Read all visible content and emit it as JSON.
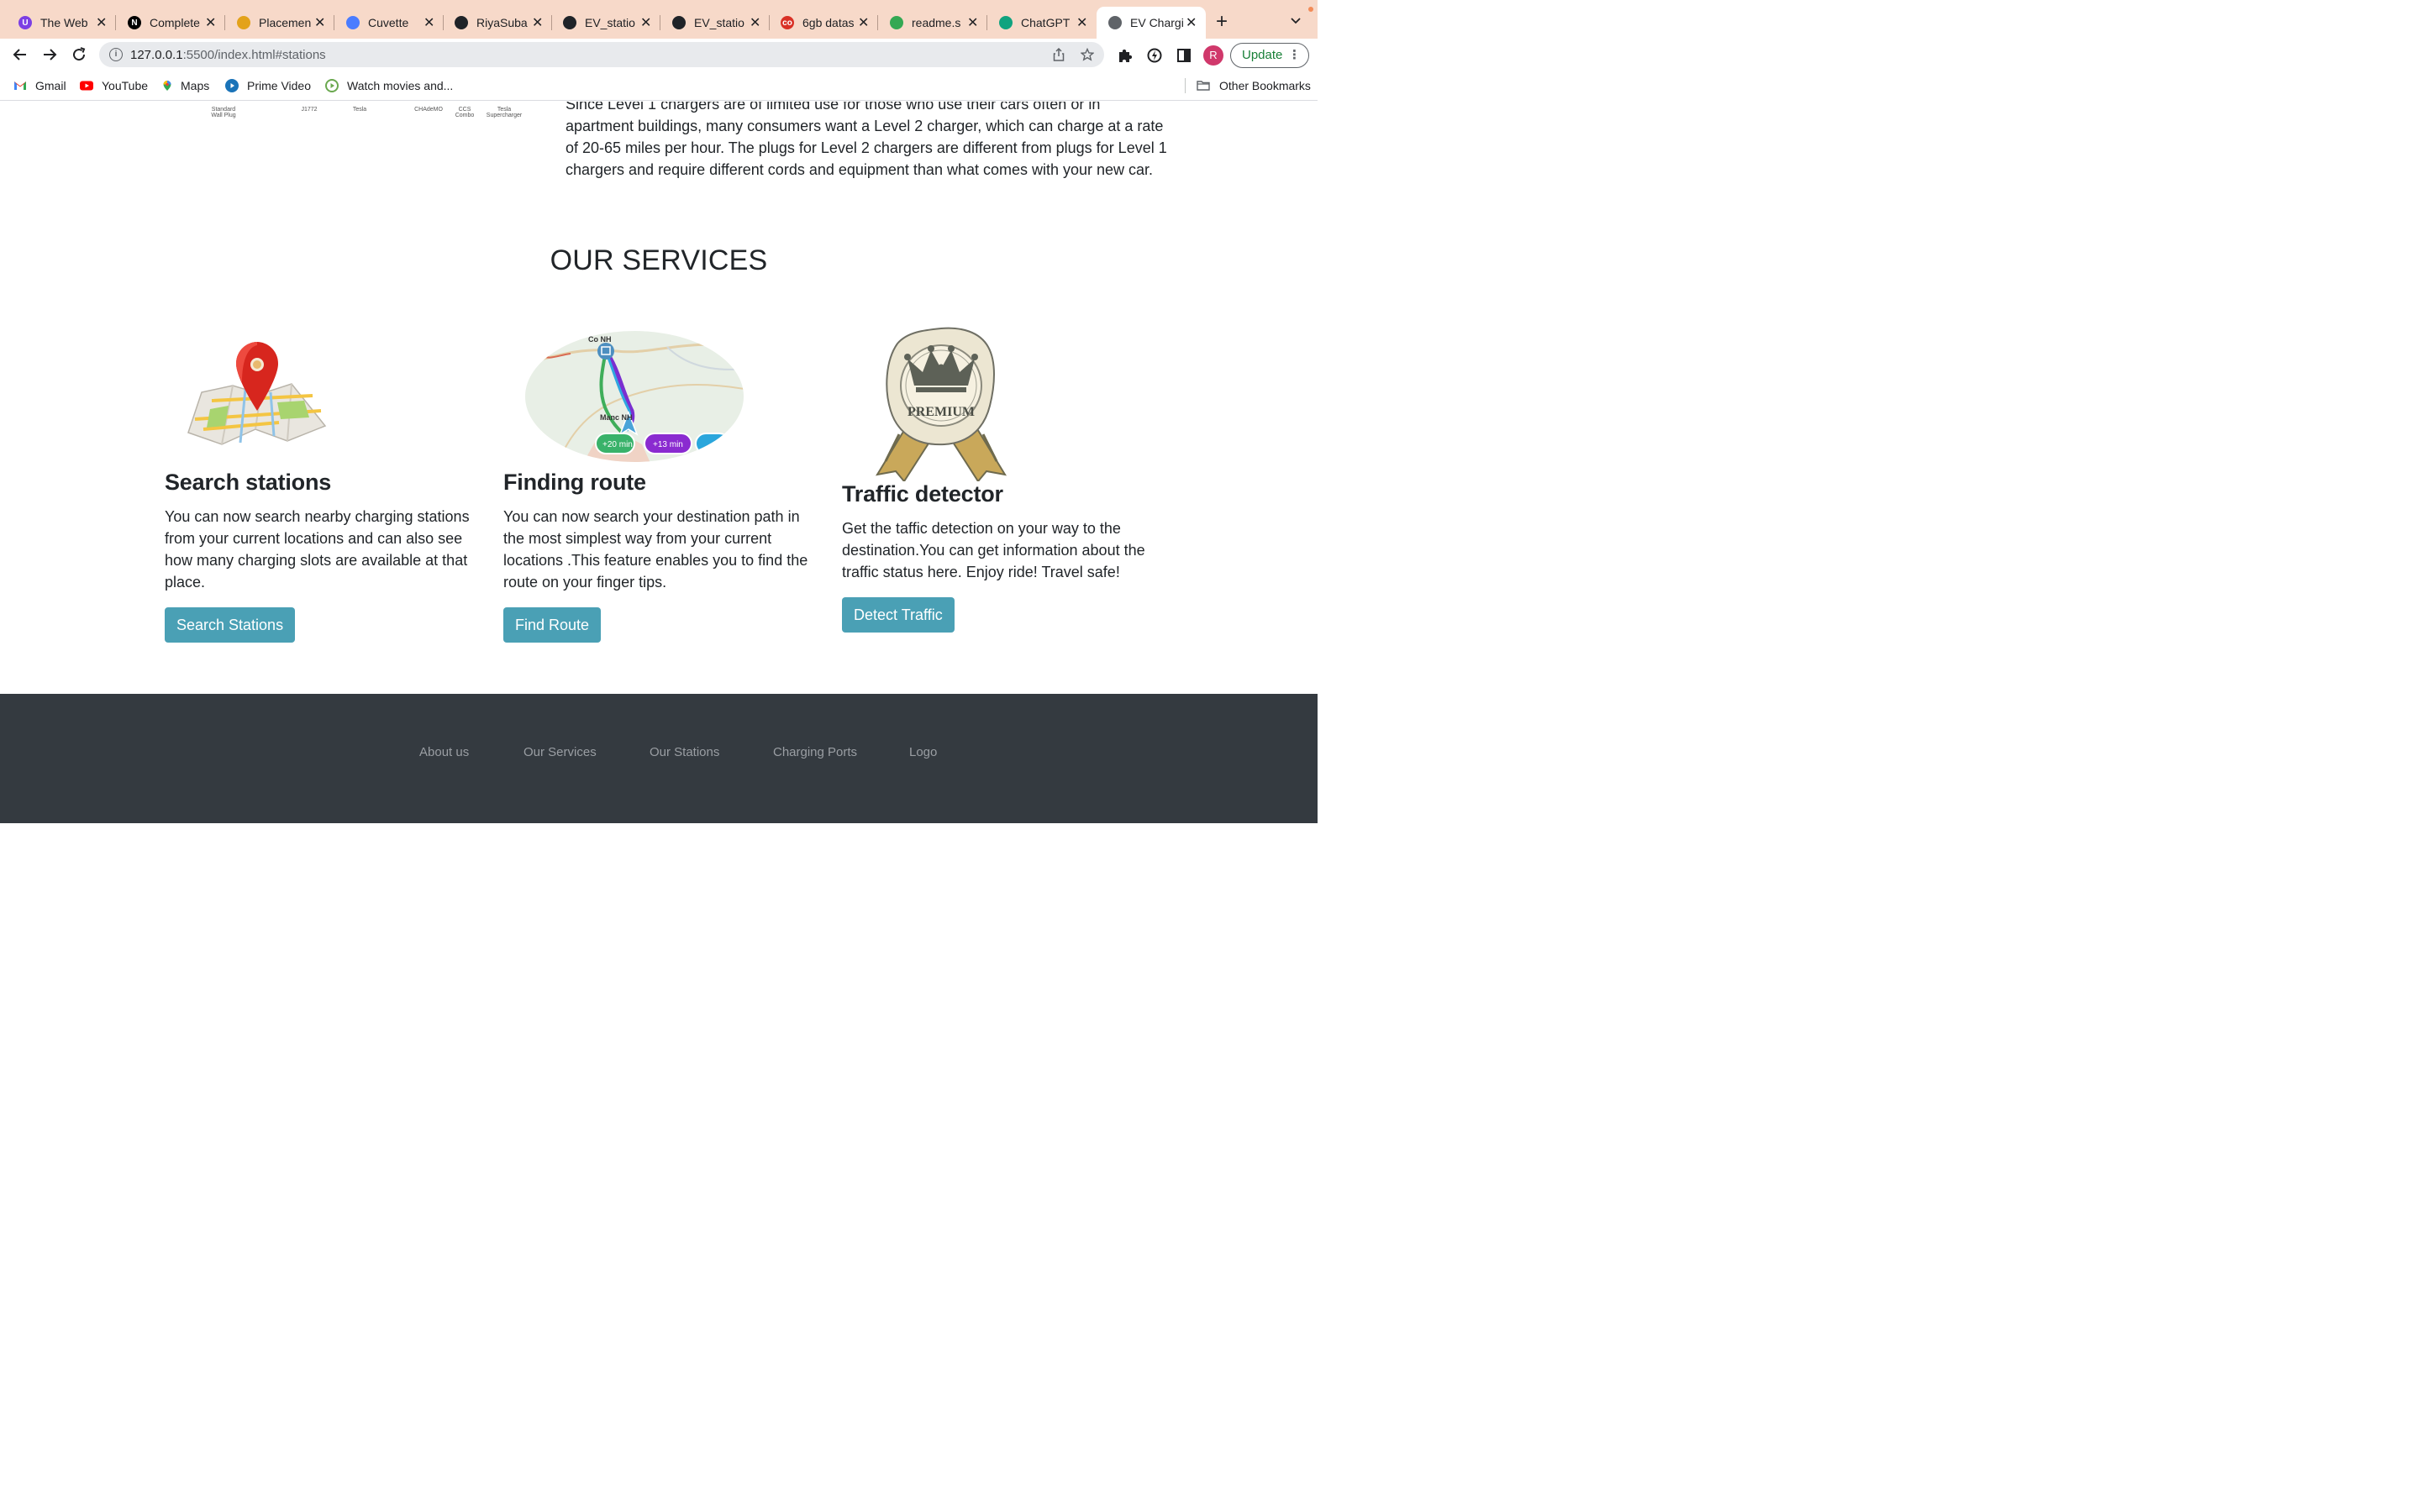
{
  "browser": {
    "tabs": [
      {
        "title": "The Web",
        "color": "#7b3fe4",
        "glyph": "U"
      },
      {
        "title": "Complete",
        "color": "#000000",
        "glyph": "N"
      },
      {
        "title": "Placemen",
        "color": "#e3a21a",
        "glyph": ""
      },
      {
        "title": "Cuvette",
        "color": "#4a7cff",
        "glyph": ""
      },
      {
        "title": "RiyaSuba",
        "color": "#1f2328",
        "glyph": ""
      },
      {
        "title": "EV_statio",
        "color": "#1f2328",
        "glyph": ""
      },
      {
        "title": "EV_statio",
        "color": "#1f2328",
        "glyph": ""
      },
      {
        "title": "6gb datas",
        "color": "#d93025",
        "glyph": "co"
      },
      {
        "title": "readme.s",
        "color": "#34a853",
        "glyph": ""
      },
      {
        "title": "ChatGPT",
        "color": "#10a37f",
        "glyph": ""
      },
      {
        "title": "EV Chargi",
        "color": "#5f6368",
        "glyph": "",
        "active": true
      }
    ],
    "url_host": "127.0.0.1",
    "url_rest": ":5500/index.html#stations",
    "profile_initial": "R",
    "update_label": "Update",
    "bookmarks": [
      {
        "label": "Gmail",
        "icon": "gmail-icon",
        "color": "#ea4335"
      },
      {
        "label": "YouTube",
        "icon": "youtube-icon",
        "color": "#ff0000"
      },
      {
        "label": "Maps",
        "icon": "maps-icon",
        "color": "#34a853"
      },
      {
        "label": "Prime Video",
        "icon": "prime-video-icon",
        "color": "#1a73b8"
      },
      {
        "label": "Watch movies and...",
        "icon": "watch-movies-icon",
        "color": "#6aa84f"
      }
    ],
    "other_bookmarks": "Other Bookmarks"
  },
  "page": {
    "plug_labels": [
      {
        "lines": [
          "Standard",
          "Wall Plug"
        ]
      },
      {
        "lines": [
          "J1772"
        ]
      },
      {
        "lines": [
          "Tesla"
        ]
      },
      {
        "lines": [
          "CHAdeMO"
        ]
      },
      {
        "lines": [
          "CCS",
          "Combo"
        ]
      },
      {
        "lines": [
          "Tesla",
          "Supercharger"
        ]
      }
    ],
    "intro_paragraph": "Since Level 1 chargers are of limited use for those who use their cars often or in apartment buildings, many consumers want a Level 2 charger, which can charge at a rate of 20-65 miles per hour. The plugs for Level 2 chargers are different from plugs for Level 1 chargers and require different cords and equipment than what comes with your new car.",
    "services_heading": "OUR SERVICES",
    "services": [
      {
        "title": "Search stations",
        "description": "You can now search nearby charging stations from your current locations and can also see how many charging slots are available at that place.",
        "button": "Search Stations"
      },
      {
        "title": "Finding route",
        "description": "You can now search your destination path in the most simplest way from your current locations .This feature enables you to find the route on your finger tips.",
        "button": "Find Route"
      },
      {
        "title": "Traffic detector",
        "description": "Get the taffic detection on your way to the destination.You can get information about the traffic status here. Enjoy ride! Travel safe!",
        "button": "Detect Traffic"
      }
    ],
    "route_map": {
      "city_top": "Co  NH",
      "city_bottom": "Manc    NH",
      "badge_green": "+20 min",
      "badge_purple": "+13 min"
    },
    "premium_label": "PREMIUM",
    "footer_links": [
      "About us",
      "Our Services",
      "Our Stations",
      "Charging Ports",
      "Logo"
    ]
  }
}
